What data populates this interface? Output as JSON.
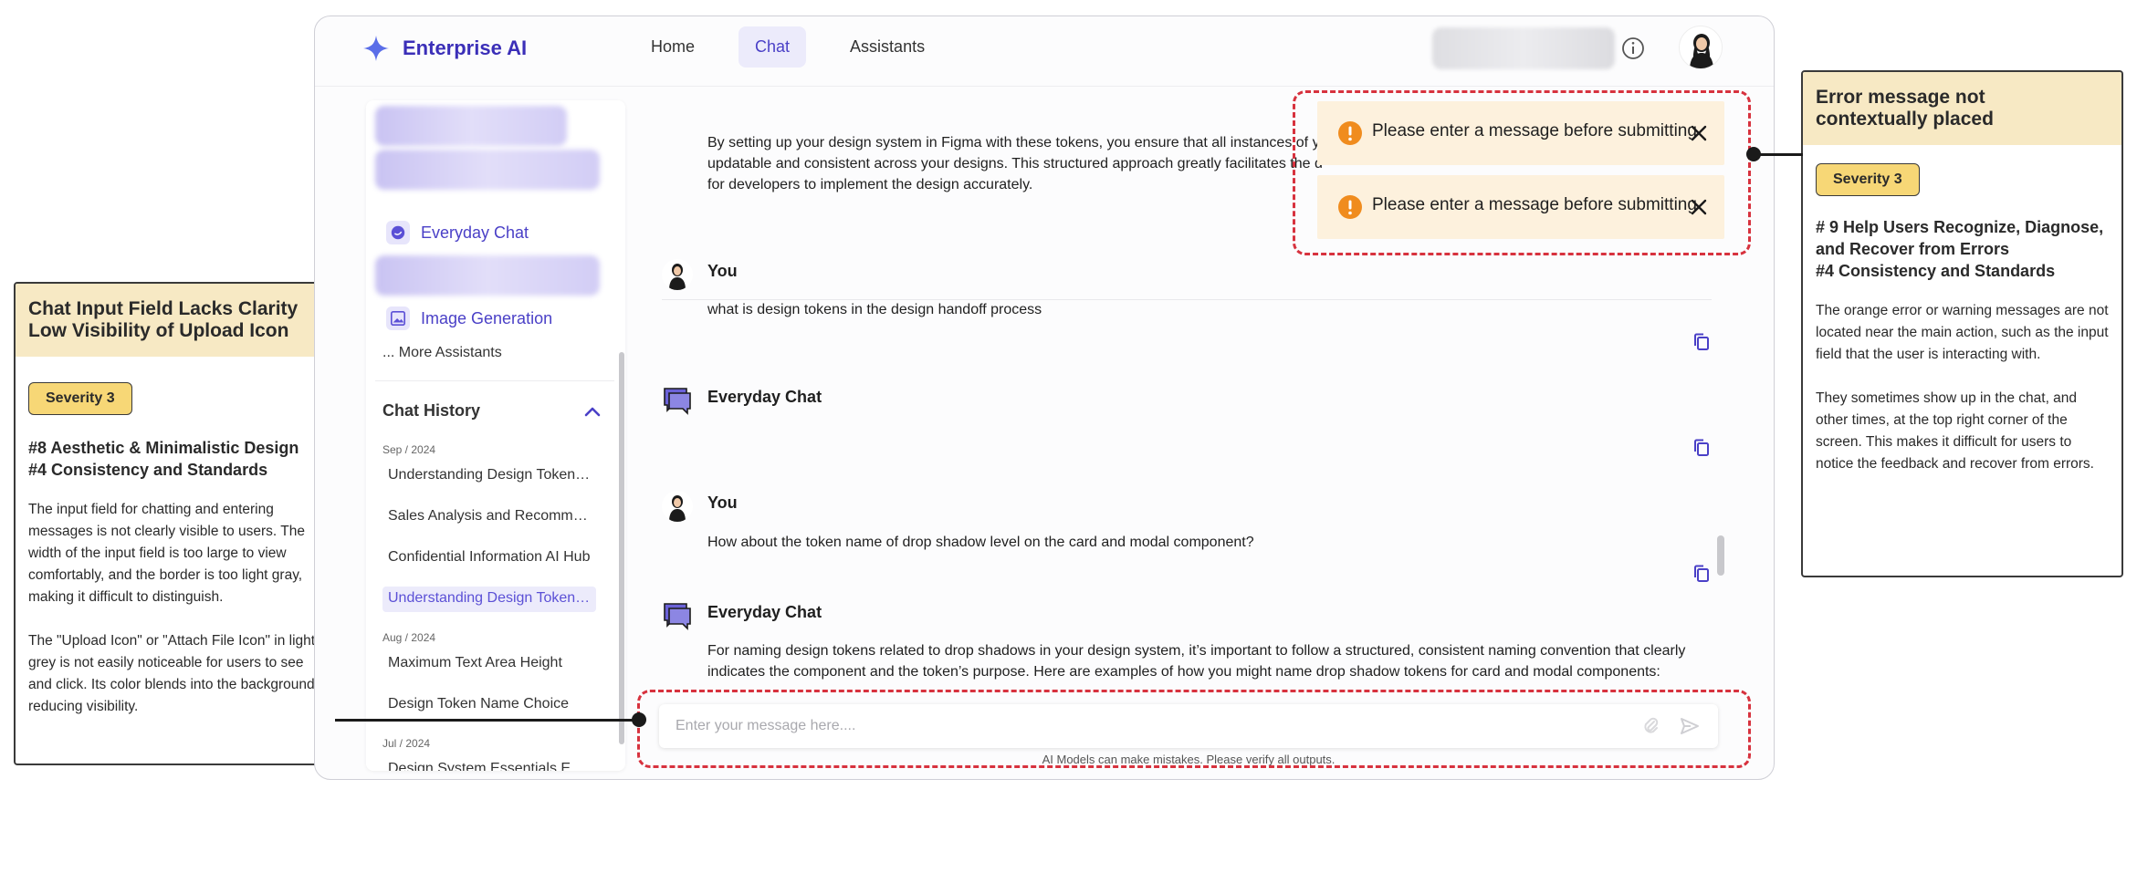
{
  "app": {
    "brand": "Enterprise AI",
    "nav": [
      "Home",
      "Chat",
      "Assistants"
    ],
    "active_nav": "Chat"
  },
  "sidebar": {
    "assistants": [
      {
        "label": "Everyday Chat"
      },
      {
        "label": "Image Generation"
      }
    ],
    "more_label": "... More Assistants",
    "history_title": "Chat History",
    "groups": [
      {
        "month": "Sep / 2024",
        "items": [
          "Understanding Design Tokens in Design Handoff",
          "Sales Analysis and Recommendations",
          "Confidential Information AI Hub",
          "Understanding Design Tokens Naming"
        ]
      },
      {
        "month": "Aug / 2024",
        "items": [
          "Maximum Text Area Height",
          "Design Token Name Choice"
        ]
      },
      {
        "month": "Jul / 2024",
        "items": [
          "Design System Essentials Explained"
        ]
      }
    ]
  },
  "chat": {
    "intro_lines": [
      "By setting up your design system in Figma with these tokens, you ensure that all instances of yo",
      "updatable and consistent across your designs. This structured approach greatly facilitates the d",
      "for developers to implement the design accurately."
    ],
    "messages": [
      {
        "sender": "You",
        "text": "what is design tokens in the design handoff process"
      },
      {
        "sender": "Everyday Chat",
        "text": ""
      },
      {
        "sender": "You",
        "text": "How about the token name of drop shadow level on the card and modal component?"
      },
      {
        "sender": "Everyday Chat",
        "text_lines": [
          "For naming design tokens related to drop shadows in your design system, it’s important to follow a structured, consistent naming convention that clearly",
          "indicates the component and the token’s purpose. Here are examples of how you might name drop shadow tokens for card and modal components:"
        ]
      }
    ],
    "input_placeholder": "Enter your message here....",
    "disclaimer": "AI Models can make mistakes. Please verify all outputs."
  },
  "toasts": [
    "Please enter a message before submitting",
    "Please enter a message before submitting"
  ],
  "annotations": {
    "left": {
      "title_lines": [
        "Chat Input Field Lacks Clarity",
        "Low Visibility of Upload Icon"
      ],
      "severity": "Severity 3",
      "heuristics": [
        "#8 Aesthetic & Minimalistic Design",
        "#4 Consistency and Standards"
      ],
      "paragraphs": [
        "The input field for chatting and entering messages is not clearly visible to users. The width of the input field is too large to view comfortably, and the border is too light gray, making it difficult to distinguish.",
        "The \"Upload Icon\" or \"Attach File Icon\" in light grey is not easily noticeable for users to see and click. Its color blends into the background, reducing visibility."
      ]
    },
    "right": {
      "title_lines": [
        "Error message not",
        "contextually placed"
      ],
      "severity": "Severity 3",
      "heuristics": [
        "# 9 Help Users Recognize, Diagnose, and Recover from Errors",
        "#4 Consistency and Standards"
      ],
      "paragraphs": [
        "The orange error or warning messages are not located near the main action, such as the input field that the user is interacting with.",
        "They sometimes show up in the chat, and other times, at the top right corner of the screen. This makes it difficult for users to notice the feedback and recover from errors."
      ]
    }
  },
  "colors": {
    "accent": "#4a40c7",
    "warning": "#f08c1e",
    "toast_bg": "#fdf1dd",
    "highlight": "#d7323e",
    "annotation_header": "#f7e9c4",
    "severity_badge": "#f7d776"
  }
}
